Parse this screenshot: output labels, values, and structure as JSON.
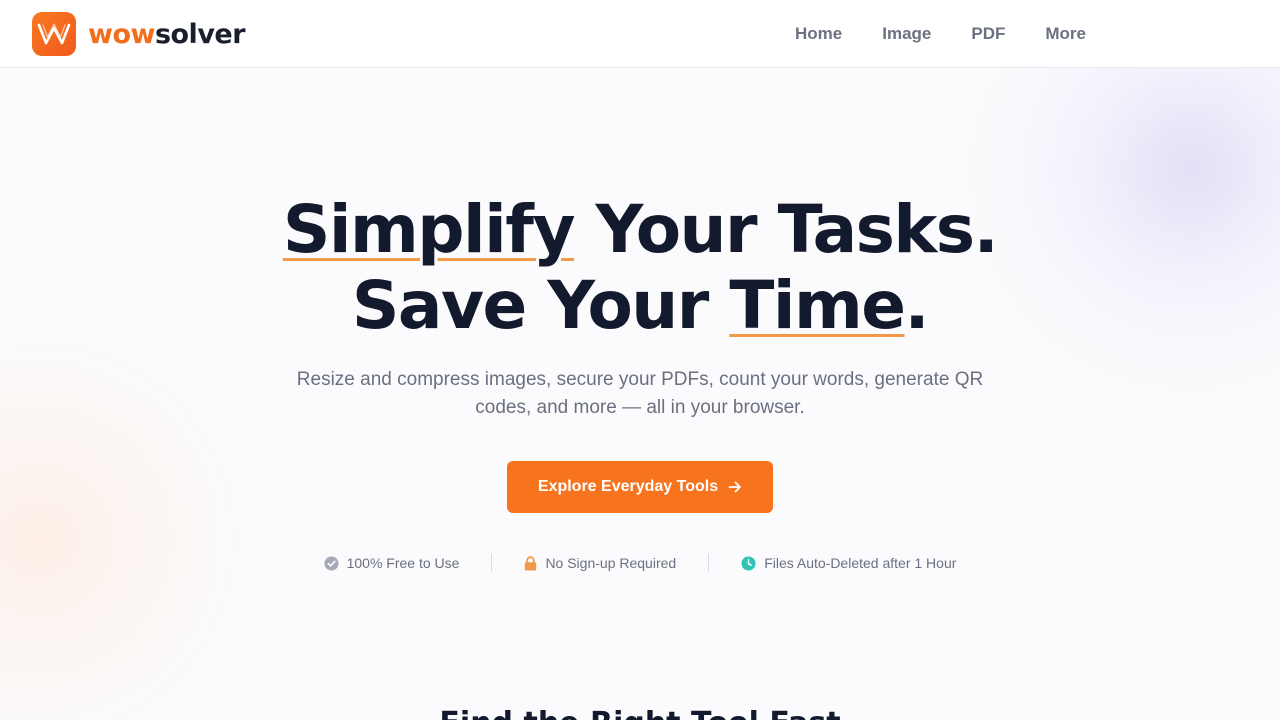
{
  "brand": {
    "name_part1": "wow",
    "name_part2": "solver",
    "accent_color": "#f7731d",
    "dark_color": "#141a2e"
  },
  "nav": {
    "items": [
      {
        "label": "Home"
      },
      {
        "label": "Image"
      },
      {
        "label": "PDF"
      },
      {
        "label": "More"
      }
    ]
  },
  "hero": {
    "title_line1_a": "Simplify",
    "title_line1_b": " Your Tasks.",
    "title_line2_a": "Save Your ",
    "title_line2_b": "Time",
    "title_line2_c": ".",
    "subtitle": "Resize and compress images, secure your PDFs, count your words, generate QR codes, and more — all in your browser.",
    "cta_label": "Explore Everyday Tools",
    "cta_icon": "arrow-right-icon"
  },
  "features": [
    {
      "label": "100% Free to Use",
      "icon": "check-circle-icon",
      "color": "#a6a9b6"
    },
    {
      "label": "No Sign-up Required",
      "icon": "lock-icon",
      "color": "#f2994a"
    },
    {
      "label": "Files Auto-Deleted after 1 Hour",
      "icon": "clock-icon",
      "color": "#2ec4b6"
    }
  ],
  "next_section": {
    "title": "Find the Right Tool Fast"
  }
}
